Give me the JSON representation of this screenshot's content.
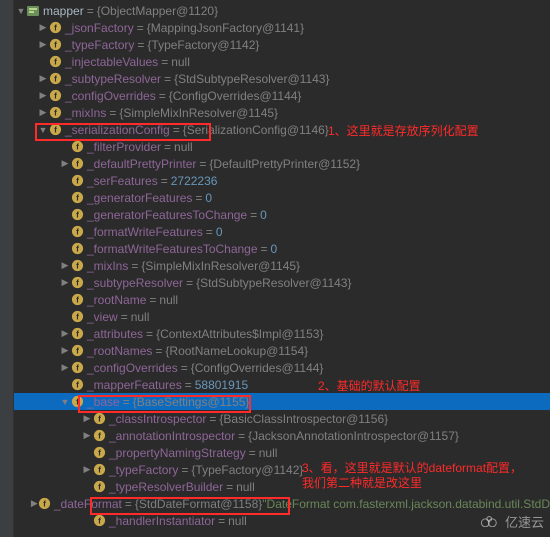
{
  "root": {
    "name": "mapper",
    "value": "{ObjectMapper@1120}"
  },
  "rows": [
    {
      "indent": 2,
      "arrow": "▶",
      "name": "_jsonFactory",
      "val": "{MappingJsonFactory@1141}",
      "kind": "type"
    },
    {
      "indent": 2,
      "arrow": "▶",
      "name": "_typeFactory",
      "val": "{TypeFactory@1142}",
      "kind": "type"
    },
    {
      "indent": 2,
      "arrow": "",
      "name": "_injectableValues",
      "val": "null",
      "kind": "null"
    },
    {
      "indent": 2,
      "arrow": "▶",
      "name": "_subtypeResolver",
      "val": "{StdSubtypeResolver@1143}",
      "kind": "type"
    },
    {
      "indent": 2,
      "arrow": "▶",
      "name": "_configOverrides",
      "val": "{ConfigOverrides@1144}",
      "kind": "type"
    },
    {
      "indent": 2,
      "arrow": "▶",
      "name": "_mixIns",
      "val": "{SimpleMixInResolver@1145}",
      "kind": "type"
    },
    {
      "indent": 2,
      "arrow": "▼",
      "name": "_serializationConfig",
      "val": "{SerializationConfig@1146}",
      "kind": "type",
      "box": 1
    },
    {
      "indent": 4,
      "arrow": "",
      "name": "_filterProvider",
      "val": "null",
      "kind": "null"
    },
    {
      "indent": 4,
      "arrow": "▶",
      "name": "_defaultPrettyPrinter",
      "val": "{DefaultPrettyPrinter@1152}",
      "kind": "type"
    },
    {
      "indent": 4,
      "arrow": "",
      "name": "_serFeatures",
      "val": "2722236",
      "kind": "num"
    },
    {
      "indent": 4,
      "arrow": "",
      "name": "_generatorFeatures",
      "val": "0",
      "kind": "num"
    },
    {
      "indent": 4,
      "arrow": "",
      "name": "_generatorFeaturesToChange",
      "val": "0",
      "kind": "num"
    },
    {
      "indent": 4,
      "arrow": "",
      "name": "_formatWriteFeatures",
      "val": "0",
      "kind": "num"
    },
    {
      "indent": 4,
      "arrow": "",
      "name": "_formatWriteFeaturesToChange",
      "val": "0",
      "kind": "num"
    },
    {
      "indent": 4,
      "arrow": "▶",
      "name": "_mixIns",
      "val": "{SimpleMixInResolver@1145}",
      "kind": "type"
    },
    {
      "indent": 4,
      "arrow": "▶",
      "name": "_subtypeResolver",
      "val": "{StdSubtypeResolver@1143}",
      "kind": "type"
    },
    {
      "indent": 4,
      "arrow": "",
      "name": "_rootName",
      "val": "null",
      "kind": "null"
    },
    {
      "indent": 4,
      "arrow": "",
      "name": "_view",
      "val": "null",
      "kind": "null"
    },
    {
      "indent": 4,
      "arrow": "▶",
      "name": "_attributes",
      "val": "{ContextAttributes$Impl@1153}",
      "kind": "type"
    },
    {
      "indent": 4,
      "arrow": "▶",
      "name": "_rootNames",
      "val": "{RootNameLookup@1154}",
      "kind": "type"
    },
    {
      "indent": 4,
      "arrow": "▶",
      "name": "_configOverrides",
      "val": "{ConfigOverrides@1144}",
      "kind": "type"
    },
    {
      "indent": 4,
      "arrow": "",
      "name": "_mapperFeatures",
      "val": "58801915",
      "kind": "num"
    },
    {
      "indent": 4,
      "arrow": "▼",
      "name": "_base",
      "val": "{BaseSettings@1155}",
      "kind": "type",
      "selected": true,
      "box": 2
    },
    {
      "indent": 6,
      "arrow": "▶",
      "name": "_classIntrospector",
      "val": "{BasicClassIntrospector@1156}",
      "kind": "type"
    },
    {
      "indent": 6,
      "arrow": "▶",
      "name": "_annotationIntrospector",
      "val": "{JacksonAnnotationIntrospector@1157}",
      "kind": "type"
    },
    {
      "indent": 6,
      "arrow": "",
      "name": "_propertyNamingStrategy",
      "val": "null",
      "kind": "null"
    },
    {
      "indent": 6,
      "arrow": "▶",
      "name": "_typeFactory",
      "val": "{TypeFactory@1142}",
      "kind": "type"
    },
    {
      "indent": 6,
      "arrow": "",
      "name": "_typeResolverBuilder",
      "val": "null",
      "kind": "null"
    },
    {
      "indent": 6,
      "arrow": "▶",
      "name": "_dateFormat",
      "val": "{StdDateFormat@1158}",
      "kind": "type",
      "extra": "\"DateFormat com.fasterxml.jackson.databind.util.StdD",
      "box": 3
    },
    {
      "indent": 6,
      "arrow": "",
      "name": "_handlerInstantiator",
      "val": "null",
      "kind": "null"
    }
  ],
  "annots": {
    "a1": "1、这里就是存放序列化配置",
    "a2": "2、基础的默认配置",
    "a3": "3、看，这里就是默认的dateformat配置，我们第二种就是改这里"
  },
  "watermark": "亿速云"
}
